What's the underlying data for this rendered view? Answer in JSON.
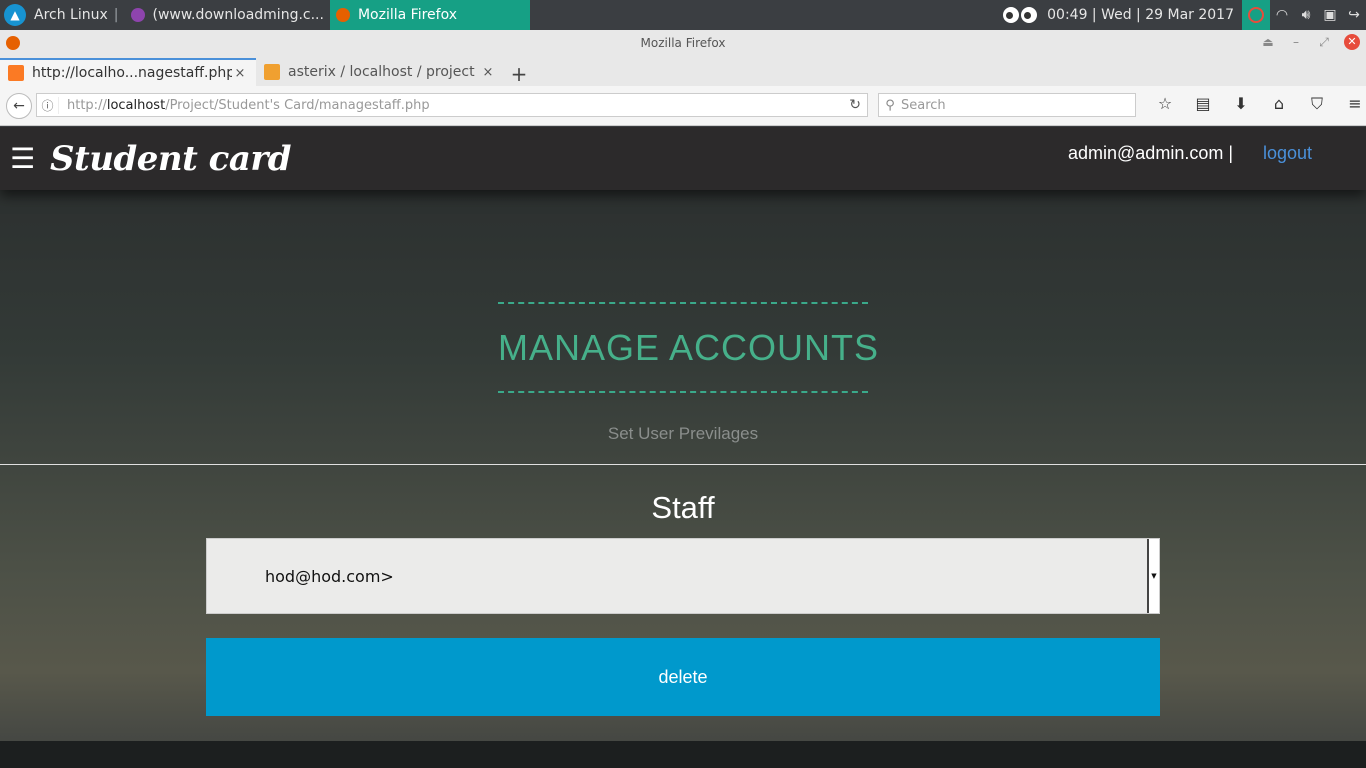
{
  "taskbar": {
    "distro": "Arch Linux",
    "separator": "|",
    "task_downloadming": "(www.downloadming.c...",
    "task_firefox": "Mozilla Firefox",
    "clock": "00:49 | Wed | 29 Mar 2017"
  },
  "window": {
    "title": "Mozilla Firefox"
  },
  "tabs": [
    {
      "label": "http://localho...nagestaff.php",
      "close": "×"
    },
    {
      "label": "asterix / localhost / project ...",
      "close": "×"
    }
  ],
  "new_tab": "+",
  "urlbar": {
    "prefix": "http://",
    "host": "localhost",
    "path": "/Project/Student's Card/managestaff.php"
  },
  "search": {
    "placeholder": "Search"
  },
  "site": {
    "logo": "Student card",
    "user_email": "admin@admin.com |",
    "logout": "logout"
  },
  "main": {
    "heading": "MANAGE ACCOUNTS",
    "subheading": "Set User Previlages",
    "section_title": "Staff",
    "selected_staff": "hod@hod.com>",
    "delete_label": "delete"
  },
  "colors": {
    "accent": "#46b08a",
    "button": "#0099cc",
    "link": "#4a90d9",
    "header": "#2c2a2b"
  }
}
